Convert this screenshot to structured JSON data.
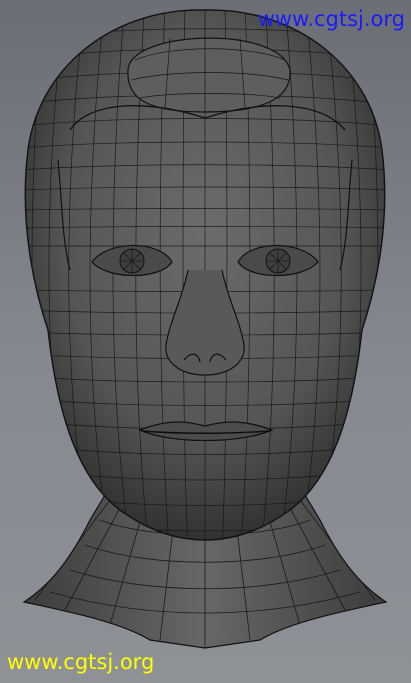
{
  "viewport": {
    "background": "#7f8288",
    "mesh_fill": "#5a5a5a",
    "wire_color": "#111111"
  },
  "model": {
    "subject": "3D wireframe head model",
    "icon": "polygon-mesh-head"
  },
  "watermarks": {
    "top": {
      "text": "www.cgtsj.org",
      "color": "#1a1aff"
    },
    "bottom": {
      "text": "www.cgtsj.org",
      "color": "#ffff00"
    }
  }
}
